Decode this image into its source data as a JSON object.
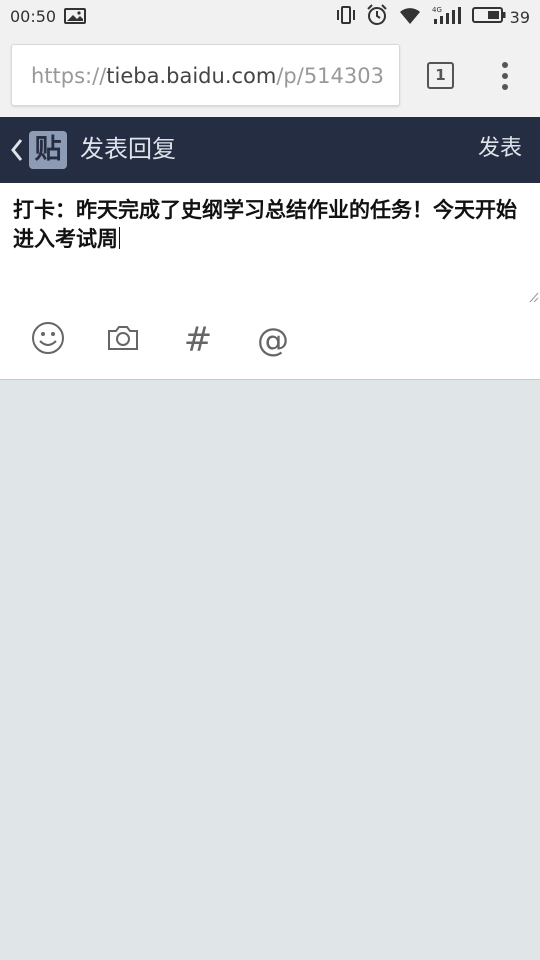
{
  "status_bar": {
    "time": "00:50",
    "battery": "39",
    "icons": [
      "image-notification-icon",
      "vibrate-icon",
      "alarm-icon",
      "wifi-icon",
      "signal-4g-icon",
      "battery-icon"
    ]
  },
  "browser": {
    "url_scheme": "https://",
    "url_domain": "tieba.baidu.com",
    "url_path": "/p/514303",
    "tab_count": "1"
  },
  "header": {
    "logo_char": "贴",
    "title": "发表回复",
    "publish_label": "发表",
    "background": "#252d42"
  },
  "editor": {
    "text": "打卡：昨天完成了史纲学习总结作业的任务！今天开始进入考试周"
  },
  "toolbar": {
    "hash_label": "#",
    "at_label": "@"
  }
}
